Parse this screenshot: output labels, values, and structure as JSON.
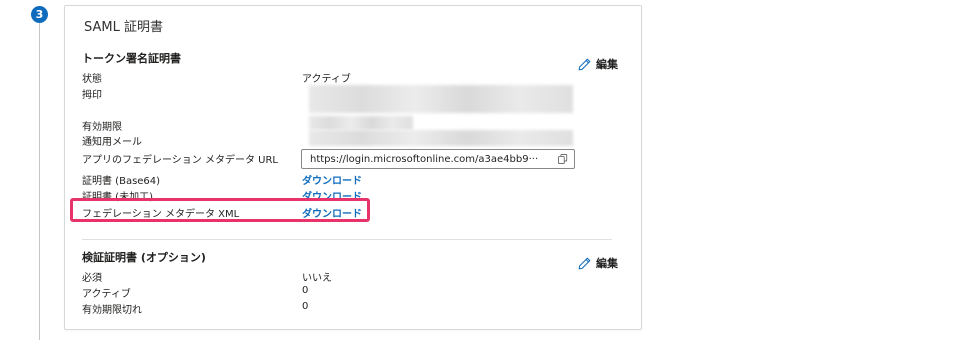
{
  "step": {
    "number": "3"
  },
  "card": {
    "title": "SAML 証明書"
  },
  "token_cert": {
    "section_title": "トークン署名証明書",
    "edit_label": "編集",
    "rows": [
      {
        "label": "状態",
        "value": "アクティブ"
      },
      {
        "label": "拇印",
        "value": ""
      },
      {
        "label": "有効期限",
        "value": ""
      },
      {
        "label": "通知用メール",
        "value": ""
      },
      {
        "label": "アプリのフェデレーション メタデータ URL",
        "value": "https://login.microsoftonline.com/a3ae4bb9···"
      },
      {
        "label": "証明書 (Base64)",
        "value": "ダウンロード"
      },
      {
        "label": "証明書 (未加工)",
        "value": "ダウンロード"
      },
      {
        "label": "フェデレーション メタデータ XML",
        "value": "ダウンロード"
      }
    ]
  },
  "verify_cert": {
    "section_title": "検証証明書 (オプション)",
    "edit_label": "編集",
    "rows": [
      {
        "label": "必須",
        "value": "いいえ"
      },
      {
        "label": "アクティブ",
        "value": "0"
      },
      {
        "label": "有効期限切れ",
        "value": "0"
      }
    ]
  },
  "colors": {
    "accent": "#0f6cbd",
    "highlight": "#e8336a"
  }
}
